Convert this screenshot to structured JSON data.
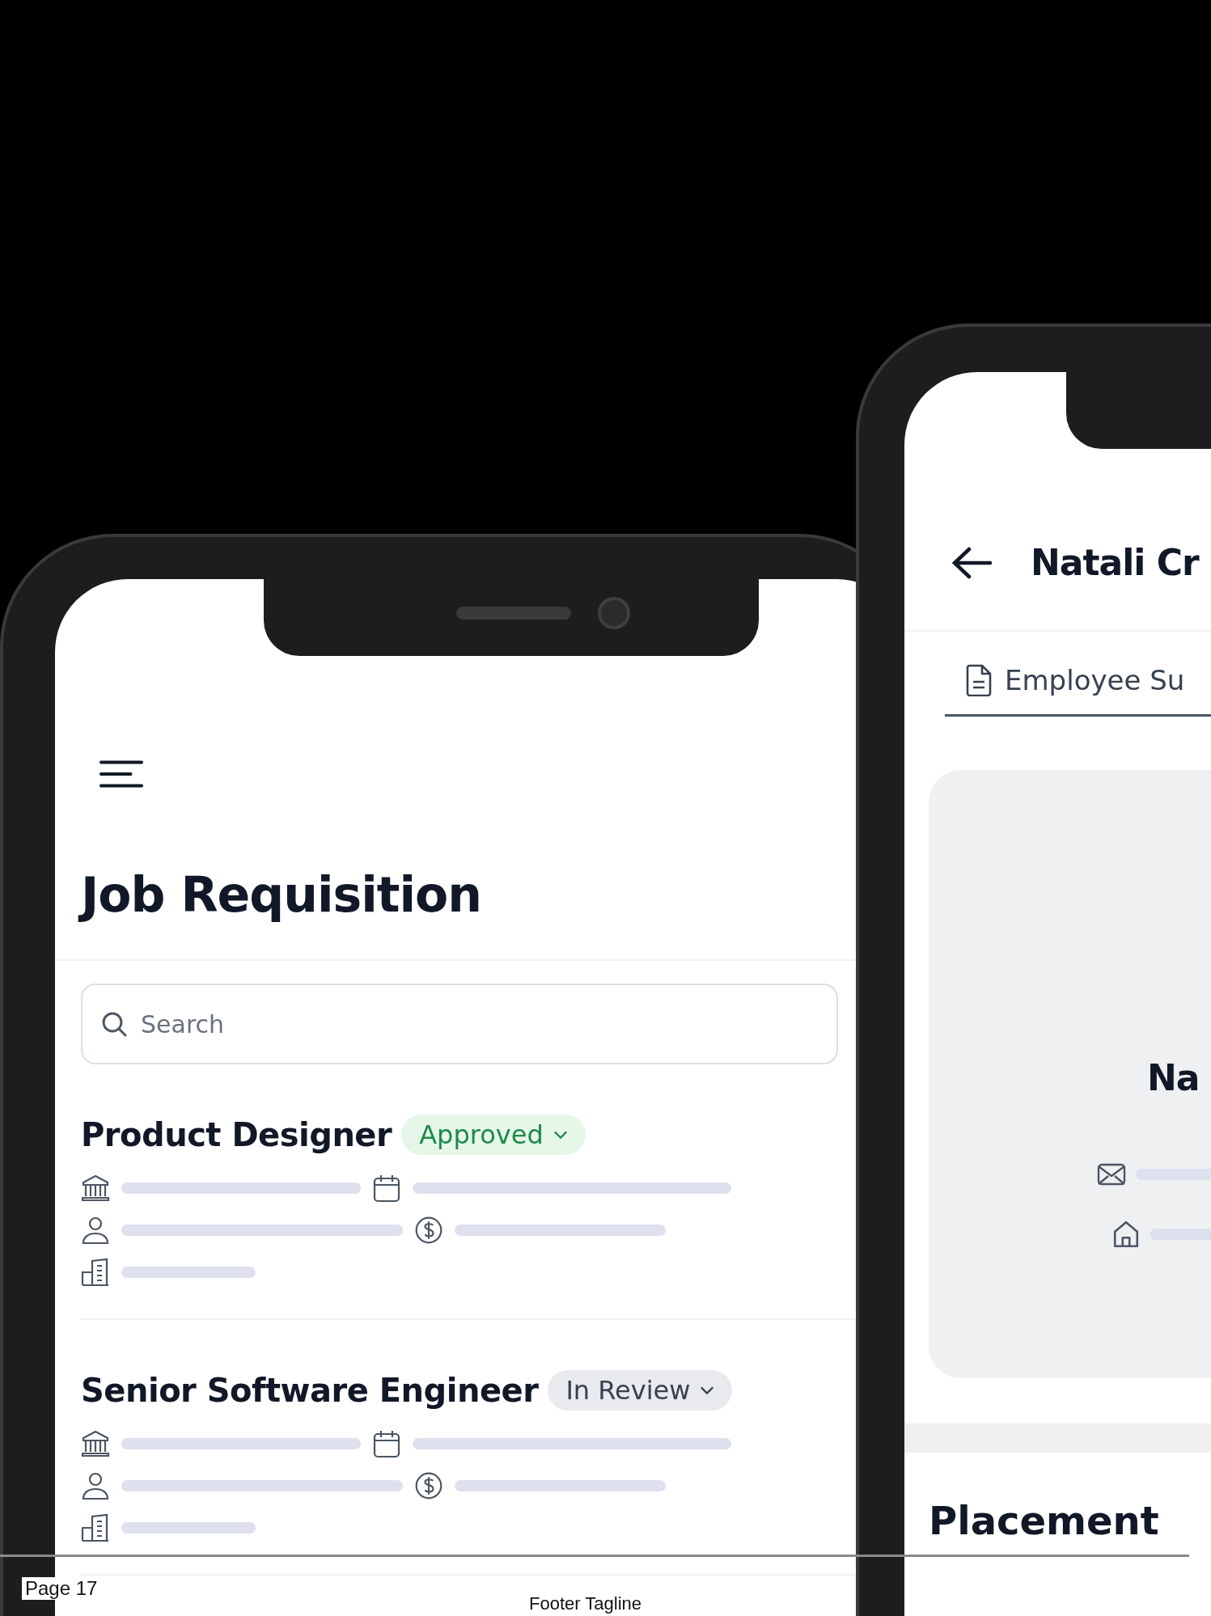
{
  "left_phone": {
    "title": "Job Requisition",
    "search": {
      "placeholder": "Search"
    },
    "requisitions": [
      {
        "title": "Product Designer",
        "status": {
          "label": "Approved",
          "kind": "approved"
        }
      },
      {
        "title": "Senior Software Engineer",
        "status": {
          "label": "In Review",
          "kind": "review"
        }
      }
    ]
  },
  "right_phone": {
    "title": "Natali Cr",
    "tabs": [
      {
        "label": "Employee Su",
        "selected": true
      }
    ],
    "card": {
      "name": "Na"
    },
    "section_title": "Placement"
  },
  "footer": {
    "page": "Page 17",
    "tagline": "Footer Tagline"
  }
}
